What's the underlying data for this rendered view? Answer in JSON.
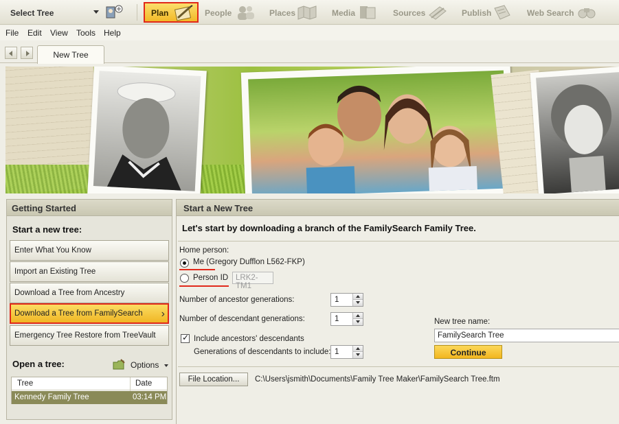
{
  "colors": {
    "highlight_border": "#e0281a",
    "accent_yellow": "#f2b928",
    "selected_row": "#8a8a58"
  },
  "toolbar": {
    "select_tree": "Select Tree",
    "tree_icon": "family-tree-icon",
    "nav": [
      {
        "label": "Plan",
        "icon": "plan-icon",
        "active": true
      },
      {
        "label": "People",
        "icon": "people-icon"
      },
      {
        "label": "Places",
        "icon": "places-icon"
      },
      {
        "label": "Media",
        "icon": "media-icon"
      },
      {
        "label": "Sources",
        "icon": "sources-icon"
      },
      {
        "label": "Publish",
        "icon": "publish-icon"
      },
      {
        "label": "Web Search",
        "icon": "binoculars-icon"
      }
    ]
  },
  "menu": [
    "File",
    "Edit",
    "View",
    "Tools",
    "Help"
  ],
  "tabs": {
    "active": "New Tree"
  },
  "left": {
    "title": "Getting Started",
    "start_title": "Start a new tree:",
    "buttons": [
      "Enter What You Know",
      "Import an Existing Tree",
      "Download a Tree from Ancestry",
      "Download a Tree from FamilySearch",
      "Emergency Tree Restore from TreeVault"
    ],
    "open_title": "Open a tree:",
    "options_label": "Options",
    "table": {
      "headers": [
        "Tree",
        "Date"
      ],
      "rows": [
        {
          "tree": "Kennedy Family Tree",
          "date": "03:14 PM"
        }
      ]
    }
  },
  "main": {
    "title": "Start a New Tree",
    "headline": "Let's start by downloading a branch of the FamilySearch Family Tree.",
    "home_person_label": "Home person:",
    "me_label": "Me (Gregory Dufflon L562-FKP)",
    "person_id_label": "Person ID",
    "person_id_placeholder": "LRK2-TM1",
    "ancestor_label": "Number of ancestor generations:",
    "ancestor_value": "1",
    "descendant_label": "Number of descendant generations:",
    "descendant_value": "1",
    "include_label": "Include ancestors' descendants",
    "gen_include_label": "Generations of descendants to include:",
    "gen_include_value": "1",
    "new_tree_label": "New tree name:",
    "new_tree_value": "FamilySearch Tree",
    "continue_label": "Continue",
    "file_location_label": "File Location...",
    "file_path": "C:\\Users\\jsmith\\Documents\\Family Tree Maker\\FamilySearch Tree.ftm"
  }
}
